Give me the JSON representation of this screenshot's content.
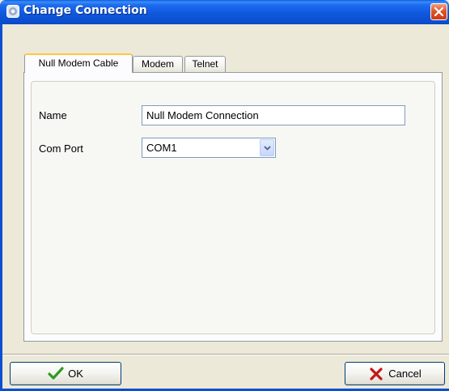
{
  "window": {
    "title": "Change Connection"
  },
  "tabs": [
    {
      "label": "Null Modem Cable",
      "active": true
    },
    {
      "label": "Modem",
      "active": false
    },
    {
      "label": "Telnet",
      "active": false
    }
  ],
  "form": {
    "name_label": "Name",
    "name_value": "Null Modem Connection",
    "com_port_label": "Com Port",
    "com_port_value": "COM1"
  },
  "buttons": {
    "ok_label": "OK",
    "cancel_label": "Cancel"
  },
  "icons": {
    "app": "connection-icon",
    "close": "close-icon",
    "ok": "checkmark-icon",
    "cancel": "x-mark-icon",
    "dropdown": "chevron-down-icon"
  },
  "colors": {
    "titlebar": "#0c4fd0",
    "dialog_bg": "#ece9d8",
    "active_tab_accent": "#ffc83c",
    "close_button": "#e2542a",
    "ok_check": "#2e9b1f",
    "cancel_x": "#c01818"
  }
}
